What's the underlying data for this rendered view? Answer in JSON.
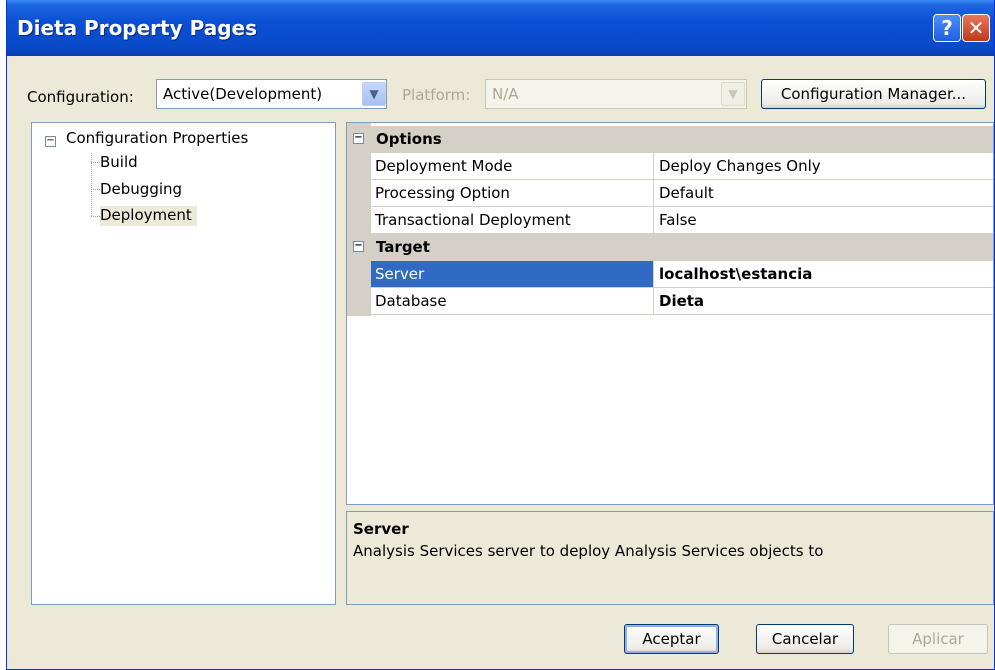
{
  "window": {
    "title": "Dieta Property Pages",
    "help_glyph": "?",
    "close_glyph": "✕"
  },
  "toolbar": {
    "configuration_label": "Configuration:",
    "configuration_value": "Active(Development)",
    "platform_label": "Platform:",
    "platform_value": "N/A",
    "config_manager_label": "Configuration Manager..."
  },
  "tree": {
    "root_label": "Configuration Properties",
    "expander": "−",
    "items": [
      {
        "label": "Build"
      },
      {
        "label": "Debugging"
      },
      {
        "label": "Deployment"
      }
    ],
    "selected": "Deployment"
  },
  "grid": {
    "categories": [
      {
        "label": "Options",
        "expander": "−",
        "rows": [
          {
            "name": "Deployment Mode",
            "value": "Deploy Changes Only"
          },
          {
            "name": "Processing Option",
            "value": "Default"
          },
          {
            "name": "Transactional Deployment",
            "value": "False"
          }
        ]
      },
      {
        "label": "Target",
        "expander": "−",
        "rows": [
          {
            "name": "Server",
            "value": "localhost\\estancia"
          },
          {
            "name": "Database",
            "value": "Dieta"
          }
        ]
      }
    ],
    "selected_row": "Server"
  },
  "description": {
    "title": "Server",
    "text": "Analysis Services server to deploy Analysis Services objects to"
  },
  "footer": {
    "ok_label": "Aceptar",
    "cancel_label": "Cancelar",
    "apply_label": "Aplicar"
  },
  "colors": {
    "titlebar": "#0a4fd4",
    "selection": "#316ac5",
    "dialog_bg": "#ece9d8"
  }
}
